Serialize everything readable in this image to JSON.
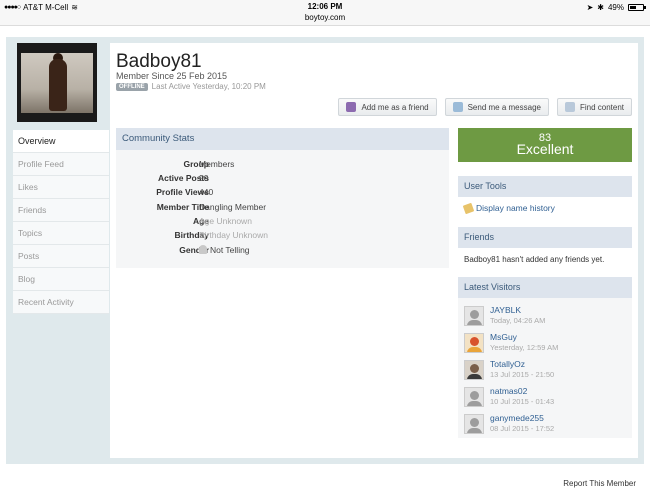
{
  "statusbar": {
    "carrier": "AT&T M-Cell",
    "time": "12:06 PM",
    "url": "boytoy.com",
    "battery": "49%",
    "battery_level": 0.49
  },
  "profile": {
    "username": "Badboy81",
    "member_since": "Member Since 25 Feb 2015",
    "status_badge": "OFFLINE",
    "last_active": "Last Active Yesterday, 10:20 PM"
  },
  "actions": {
    "add_friend": "Add me as a friend",
    "send_message": "Send me a message",
    "find_content": "Find content"
  },
  "nav": {
    "items": [
      {
        "label": "Overview"
      },
      {
        "label": "Profile Feed"
      },
      {
        "label": "Likes"
      },
      {
        "label": "Friends"
      },
      {
        "label": "Topics"
      },
      {
        "label": "Posts"
      },
      {
        "label": "Blog"
      },
      {
        "label": "Recent Activity"
      }
    ]
  },
  "stats": {
    "title": "Community Stats",
    "rows": [
      {
        "label": "Group",
        "value": "Members"
      },
      {
        "label": "Active Posts",
        "value": "90"
      },
      {
        "label": "Profile Views",
        "value": "440"
      },
      {
        "label": "Member Title",
        "value": "Dangling Member"
      },
      {
        "label": "Age",
        "value": "Age Unknown"
      },
      {
        "label": "Birthday",
        "value": "Birthday Unknown"
      },
      {
        "label": "Gender",
        "value": "Not Telling"
      }
    ]
  },
  "reputation": {
    "value": "83",
    "label": "Excellent",
    "color": "#6e9a43"
  },
  "user_tools": {
    "title": "User Tools",
    "display_name_history": "Display name history"
  },
  "friends": {
    "title": "Friends",
    "empty_text": "Badboy81 hasn't added any friends yet."
  },
  "visitors": {
    "title": "Latest Visitors",
    "items": [
      {
        "name": "JAYBLK",
        "time": "Today, 04:26 AM"
      },
      {
        "name": "MsGuy",
        "time": "Yesterday, 12:59 AM"
      },
      {
        "name": "TotallyOz",
        "time": "13 Jul 2015 - 21:50"
      },
      {
        "name": "natmas02",
        "time": "10 Jul 2015 - 01:43"
      },
      {
        "name": "ganymede255",
        "time": "08 Jul 2015 - 17:52"
      }
    ]
  },
  "footer": {
    "report": "Report This Member"
  }
}
